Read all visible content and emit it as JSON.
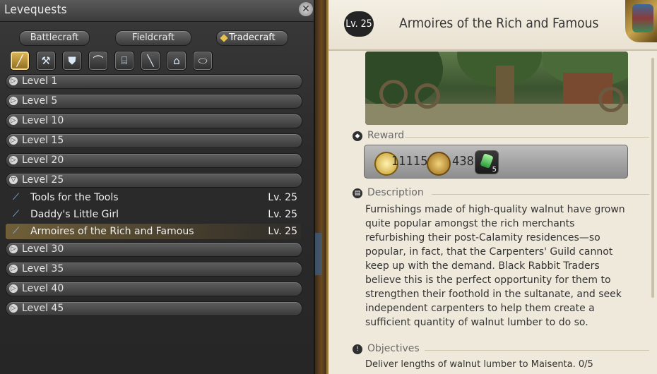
{
  "window_title": "Levequests",
  "tabs": [
    "Battlecraft",
    "Fieldcraft",
    "Tradecraft"
  ],
  "active_tab": "Tradecraft",
  "class_icons": [
    {
      "name": "carpenter-icon",
      "glyph": "╱",
      "selected": true
    },
    {
      "name": "blacksmith-icon",
      "glyph": "⚒",
      "selected": false
    },
    {
      "name": "armorer-icon",
      "glyph": "⛊",
      "selected": false
    },
    {
      "name": "goldsmith-icon",
      "glyph": "⌒",
      "selected": false
    },
    {
      "name": "leatherworker-icon",
      "glyph": "⌸",
      "selected": false
    },
    {
      "name": "weaver-icon",
      "glyph": "╲",
      "selected": false
    },
    {
      "name": "alchemist-icon",
      "glyph": "⌂",
      "selected": false
    },
    {
      "name": "culinarian-icon",
      "glyph": "⬭",
      "selected": false
    }
  ],
  "levels_before": [
    "Level 1",
    "Level 5",
    "Level 10",
    "Level 15",
    "Level 20"
  ],
  "expanded_level": "Level 25",
  "quests": [
    {
      "name": "Tools for the Tools",
      "level": "Lv. 25",
      "selected": false
    },
    {
      "name": "Daddy's Little Girl",
      "level": "Lv. 25",
      "selected": false
    },
    {
      "name": "Armoires of the Rich and Famous",
      "level": "Lv. 25",
      "selected": true
    }
  ],
  "levels_after": [
    "Level 30",
    "Level 35",
    "Level 40",
    "Level 45"
  ],
  "detail": {
    "level_badge": "Lv. 25",
    "title": "Armoires of the Rich and Famous",
    "reward_heading": "Reward",
    "rewards": {
      "exp": "11115",
      "gil": "438",
      "crystal_count": "5"
    },
    "description_heading": "Description",
    "description": "Furnishings made of high-quality walnut have grown quite popular amongst the rich merchants refurbishing their post-Calamity residences—so popular, in fact, that the Carpenters' Guild cannot keep up with the demand. Black Rabbit Traders believe this is the perfect opportunity for them to strengthen their foothold in the sultanate, and seek independent carpenters to help them create a sufficient quantity of walnut lumber to do so.",
    "objectives_heading": "Objectives",
    "objective": "Deliver lengths of walnut lumber to Maisenta. 0/5"
  },
  "colors": {
    "accent_gold": "#e6c24d",
    "panel_bg": "#2b2b2b",
    "detail_bg": "#efe9dc"
  }
}
